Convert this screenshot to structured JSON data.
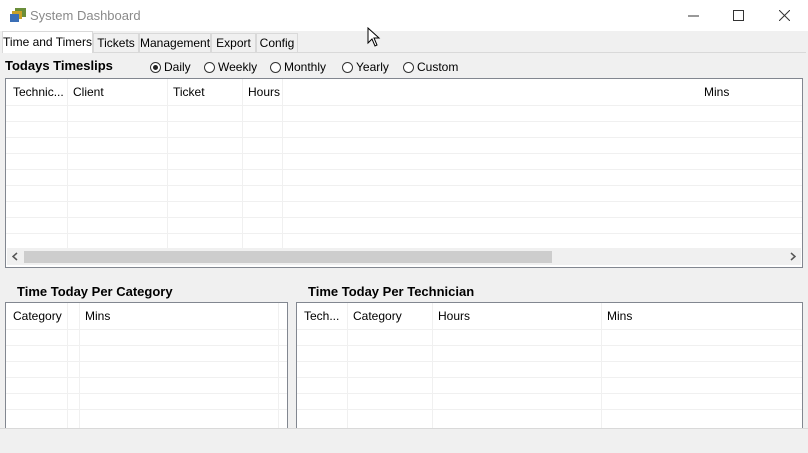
{
  "window": {
    "title": "System Dashboard"
  },
  "tabs": [
    {
      "label": "Time and Timers",
      "active": true
    },
    {
      "label": "Tickets",
      "active": false
    },
    {
      "label": "Management",
      "active": false
    },
    {
      "label": "Export",
      "active": false
    },
    {
      "label": "Config",
      "active": false
    }
  ],
  "timeslips": {
    "title": "Todays Timeslips",
    "period_options": [
      {
        "label": "Daily",
        "selected": true
      },
      {
        "label": "Weekly",
        "selected": false
      },
      {
        "label": "Monthly",
        "selected": false
      },
      {
        "label": "Yearly",
        "selected": false
      },
      {
        "label": "Custom",
        "selected": false
      }
    ],
    "columns": [
      "Technic...",
      "Client",
      "Ticket",
      "Hours",
      "Mins"
    ]
  },
  "per_category": {
    "title": "Time Today Per Category",
    "columns": [
      "Category",
      "",
      "Mins"
    ]
  },
  "per_technician": {
    "title": "Time Today Per Technician",
    "columns": [
      "Tech...",
      "Category",
      "Hours",
      "Mins"
    ]
  },
  "colors": {
    "window_bg": "#f0f0f0",
    "grid_border": "#828790",
    "gridline": "#f0f0f0"
  }
}
